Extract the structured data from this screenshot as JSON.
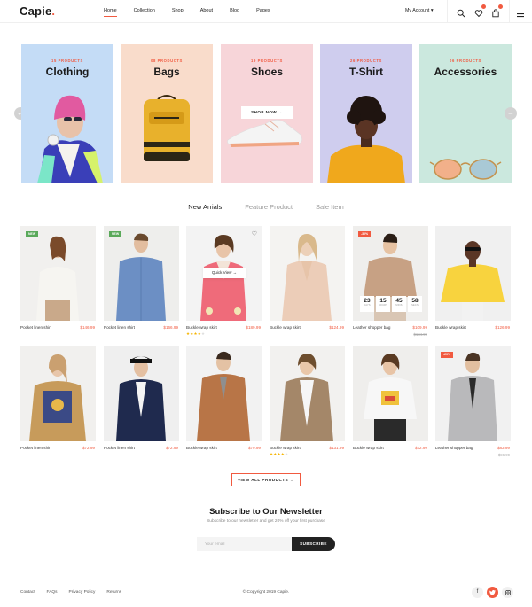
{
  "header": {
    "logo": "Capie",
    "logo_dot": ".",
    "nav": [
      "Home",
      "Collection",
      "Shop",
      "About",
      "Blog",
      "Pages"
    ],
    "account": "My Account",
    "icons": [
      "search-icon",
      "heart-icon",
      "cart-icon",
      "menu-icon"
    ],
    "accent": "#f15a40"
  },
  "categories": [
    {
      "count": "15 PRODUCTS",
      "title": "Clothing",
      "bg": "#c4dcf6"
    },
    {
      "count": "08 PRODUCTS",
      "title": "Bags",
      "bg": "#f9dccb"
    },
    {
      "count": "19 PRODUCTS",
      "title": "Shoes",
      "bg": "#f7d5d9",
      "cta": "SHOP NOW"
    },
    {
      "count": "26 PRODUCTS",
      "title": "T-Shirt",
      "bg": "#cfcdee"
    },
    {
      "count": "06 PRODUCTS",
      "title": "Accessories",
      "bg": "#cbe8de"
    }
  ],
  "tabs": [
    "New Arrials",
    "Feature Product",
    "Sale Item"
  ],
  "products": [
    {
      "name": "Pocket linen shirt",
      "price": "$146.99",
      "tag": "NEW"
    },
    {
      "name": "Pocket linen shirt",
      "price": "$166.99",
      "tag": "NEW"
    },
    {
      "name": "Buckle wrap skirt",
      "price": "$189.99",
      "quick_view": "Quick View",
      "rating": 4
    },
    {
      "name": "Buckle wrap skirt",
      "price": "$124.99"
    },
    {
      "name": "Leather shopper bag",
      "price": "$109.99",
      "old_price": "$134.99",
      "tag": "-30%",
      "countdown": [
        {
          "v": "23",
          "l": "DAYS"
        },
        {
          "v": "15",
          "l": "HOURS"
        },
        {
          "v": "45",
          "l": "MINS"
        },
        {
          "v": "58",
          "l": "SECS"
        }
      ]
    },
    {
      "name": "Buckle wrap skirt",
      "price": "$126.99"
    },
    {
      "name": "Pocket linen shirt",
      "price": "$72.99"
    },
    {
      "name": "Pocket linen shirt",
      "price": "$72.99"
    },
    {
      "name": "Buckle wrap skirt",
      "price": "$79.99"
    },
    {
      "name": "Buckle wrap skirt",
      "price": "$131.99",
      "rating": 4
    },
    {
      "name": "Buckle wrap skirt",
      "price": "$72.99"
    },
    {
      "name": "Leather shopper bag",
      "price": "$83.99",
      "old_price": "$96.99",
      "tag": "-20%"
    }
  ],
  "view_all": "VIEW ALL PRODUCTS",
  "newsletter": {
    "title": "Subscribe to Our Newsletter",
    "subtitle": "Subscribe to our newsletter and get 20% off your first purchase",
    "placeholder": "Your email",
    "button": "SUBSCRIBE"
  },
  "footer": {
    "links": [
      "Contact",
      "FAQs",
      "Privacy Policy",
      "Returns"
    ],
    "copyright": "© Copyright 2019 Capie.",
    "social": [
      "f",
      "t",
      "ig"
    ]
  }
}
